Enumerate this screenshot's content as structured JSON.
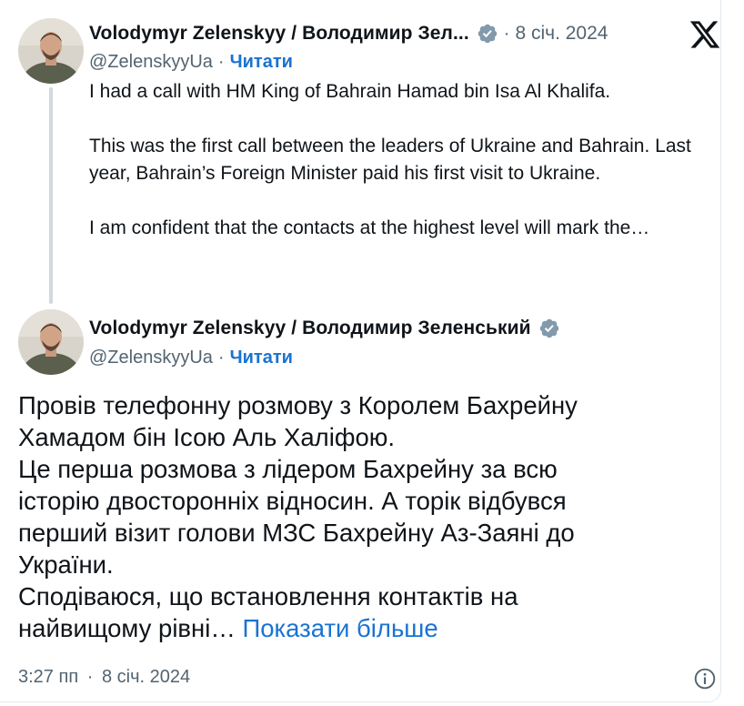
{
  "reply_tweet": {
    "author_name": "Volodymyr Zelenskyy / Володимир Зел...",
    "handle": "@ZelenskyyUa",
    "follow_label": "Читати",
    "date": "8 січ. 2024",
    "paragraphs": [
      "I had a call with HM King of Bahrain Hamad bin Isa Al Khalifa.",
      "This was the first call between the leaders of Ukraine and Bahrain. Last year, Bahrain’s Foreign Minister paid his first visit to Ukraine.",
      "I am confident that the contacts at the highest level will mark the…"
    ]
  },
  "main_tweet": {
    "author_name": "Volodymyr Zelenskyy / Володимир Зеленський",
    "handle": "@ZelenskyyUa",
    "follow_label": "Читати",
    "lines": [
      "Провів телефонну розмову з Королем Бахрейну",
      "Хамадом бін Ісою Аль Халіфою.",
      "Це перша розмова з лідером Бахрейну за всю",
      "історію двосторонніх відносин. А торік відбувся",
      "перший візит голови МЗС Бахрейну Аз-Заяні до",
      "України.",
      "Сподіваюся, що встановлення контактів на"
    ],
    "last_line": "найвищому рівні…",
    "show_more_label": "Показати більше",
    "time": "3:27 пп",
    "date": "8 січ. 2024"
  },
  "separator": "·",
  "icons": {
    "verified": "verified-badge-icon",
    "brand": "x-logo-icon",
    "info": "info-icon"
  },
  "colors": {
    "link": "#1a73d0",
    "secondary_text": "#536471",
    "verified_badge": "#829aab",
    "thread_line": "#cfd9de"
  }
}
